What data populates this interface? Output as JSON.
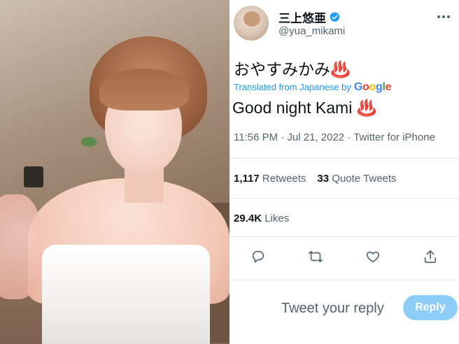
{
  "tweet": {
    "display_name": "三上悠亜",
    "handle": "@yua_mikami",
    "verified_icon": "verified-badge-icon",
    "more_icon": "more-dots-icon",
    "original_text": "おやすみかみ♨️",
    "translated_label": "Translated from Japanese by",
    "translator_brand": "Google",
    "translated_text": "Good night Kami ♨️",
    "timestamp": "11:56 PM · Jul 21, 2022 · Twitter for iPhone",
    "stats": {
      "retweets_count": "1,117",
      "retweets_label": "Retweets",
      "quotes_count": "33",
      "quotes_label": "Quote Tweets",
      "likes_count": "29.4K",
      "likes_label": "Likes"
    },
    "actions": [
      "reply-icon",
      "retweet-icon",
      "like-icon",
      "share-icon"
    ],
    "reply_placeholder": "Tweet your reply",
    "reply_button": "Reply"
  },
  "colors": {
    "accent": "#1d9bf0",
    "reply_button_disabled": "#8ecdf8",
    "text_primary": "#0f1419",
    "text_secondary": "#536471",
    "divider": "#e4e8ea"
  }
}
